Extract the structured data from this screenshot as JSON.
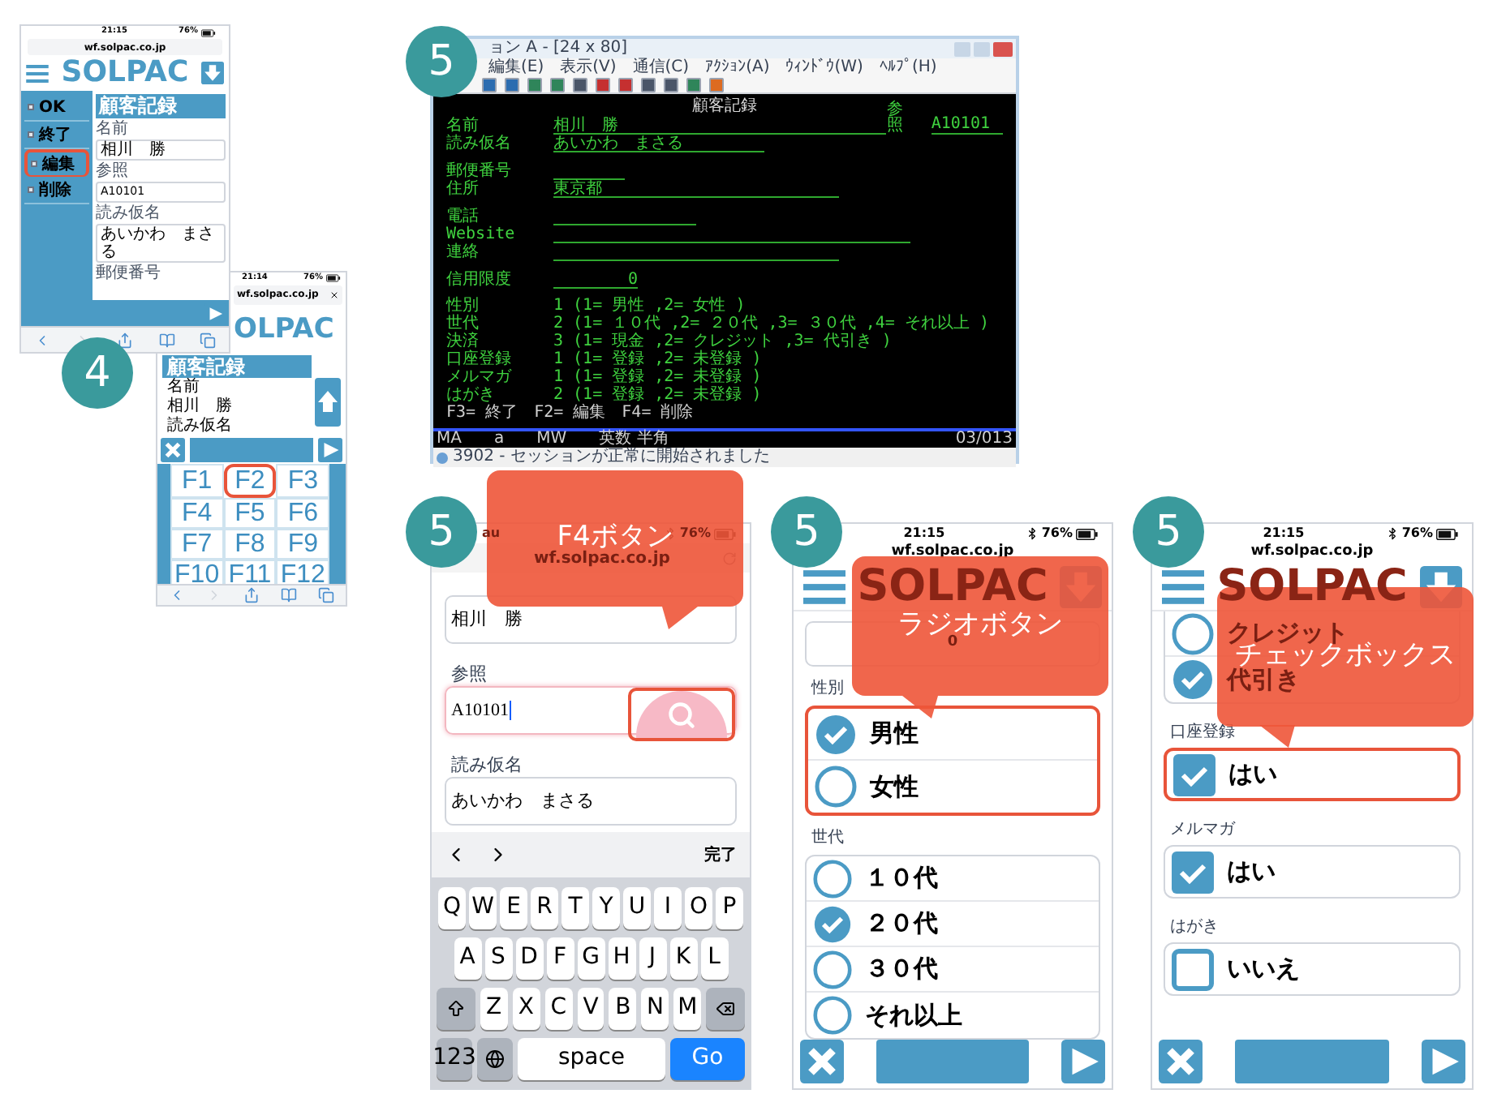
{
  "phone_menu": {
    "status": {
      "time": "21:15",
      "battery": "76%"
    },
    "url": "wf.solpac.co.jp",
    "logo": "SOLPAC",
    "menu": [
      {
        "label": "OK",
        "highlighted": false
      },
      {
        "label": "終了",
        "highlighted": false
      },
      {
        "label": "編集",
        "highlighted": true
      },
      {
        "label": "削除",
        "highlighted": false
      }
    ],
    "title": "顧客記録",
    "fields": [
      {
        "label": "名前",
        "value": "相川　勝"
      },
      {
        "label": "参照",
        "value": "A10101"
      },
      {
        "label": "読み仮名",
        "value": "あいかわ　まさる"
      },
      {
        "label": "郵便番号"
      }
    ]
  },
  "phone_fkeys": {
    "step": "4",
    "status": {
      "time": "21:14",
      "battery": "76%"
    },
    "url": "wf.solpac.co.jp",
    "logo": "OLPAC",
    "title": "顧客記録",
    "lines": [
      "名前",
      "相川　勝",
      "読み仮名"
    ],
    "keys": [
      {
        "label": "F1",
        "highlighted": false
      },
      {
        "label": "F2",
        "highlighted": true
      },
      {
        "label": "F3",
        "highlighted": false
      },
      {
        "label": "F4",
        "highlighted": false
      },
      {
        "label": "F5",
        "highlighted": false
      },
      {
        "label": "F6",
        "highlighted": false
      },
      {
        "label": "F7",
        "highlighted": false
      },
      {
        "label": "F8",
        "highlighted": false
      },
      {
        "label": "F9",
        "highlighted": false
      },
      {
        "label": "F10",
        "highlighted": false
      },
      {
        "label": "F11",
        "highlighted": false
      },
      {
        "label": "F12",
        "highlighted": false
      }
    ]
  },
  "terminal": {
    "step": "5",
    "title": "ョン A - [24 x 80]",
    "menu": [
      "編集(E)",
      "表示(V)",
      "通信(C)",
      "ｱｸｼｮﾝ(A)",
      "ｳｨﾝﾄﾞｳ(W)",
      "ﾍﾙﾌﾟ(H)"
    ],
    "heading": "顧客記録",
    "rows": [
      {
        "kind": "field",
        "label": "名前",
        "value": "相川　勝",
        "extra_label": "参照",
        "extra_value": "A10101"
      },
      {
        "kind": "field",
        "label": "読み仮名",
        "value": "あいかわ　まさる"
      },
      {
        "kind": "gap"
      },
      {
        "kind": "field",
        "label": "郵便番号"
      },
      {
        "kind": "field",
        "label": "住所",
        "value": "東京都"
      },
      {
        "kind": "gap"
      },
      {
        "kind": "field",
        "label": "電話"
      },
      {
        "kind": "field",
        "label": "Website"
      },
      {
        "kind": "field",
        "label": "連絡"
      },
      {
        "kind": "gap"
      },
      {
        "kind": "number",
        "label": "信用限度",
        "value": "0"
      },
      {
        "kind": "gap"
      },
      {
        "kind": "option",
        "label": "性別",
        "value": "1 (1= 男性 ,2= 女性 )"
      },
      {
        "kind": "option",
        "label": "世代",
        "value": "2 (1= １０代 ,2= ２０代 ,3= ３０代 ,4= それ以上 )"
      },
      {
        "kind": "option",
        "label": "決済",
        "value": "3 (1= 現金 ,2= クレジット ,3= 代引き )"
      },
      {
        "kind": "option",
        "label": "口座登録",
        "value": "1 (1= 登録 ,2= 未登録 )"
      },
      {
        "kind": "option",
        "label": "メルマガ",
        "value": "1 (1= 登録 ,2= 未登録 )"
      },
      {
        "kind": "option",
        "label": "はがき",
        "value": "2 (1= 登録 ,2= 未登録 )"
      }
    ],
    "function_keys": "F3= 終了　F2= 編集　F4= 削除",
    "indicators": [
      "MA",
      "a",
      "MW",
      "英数 半角"
    ],
    "cursor": "03/013",
    "status_bar": "3902 - セッションが正常に開始されました"
  },
  "phone_keyboard": {
    "step": "5",
    "callout": "F4ボタン",
    "status": {
      "carrier": "au",
      "battery": "76%"
    },
    "url": "wf.solpac.co.jp",
    "fields": [
      {
        "value": "相川　勝",
        "focused": false
      },
      {
        "label": "参照",
        "value": "A10101",
        "focused": true
      },
      {
        "label": "読み仮名",
        "value": "あいかわ　まさる",
        "focused": false
      }
    ],
    "search_highlighted": true,
    "done": "完了",
    "keyboard": [
      [
        {
          "kind": "key",
          "label": "Q"
        },
        {
          "kind": "key",
          "label": "W"
        },
        {
          "kind": "key",
          "label": "E"
        },
        {
          "kind": "key",
          "label": "R"
        },
        {
          "kind": "key",
          "label": "T"
        },
        {
          "kind": "key",
          "label": "Y"
        },
        {
          "kind": "key",
          "label": "U"
        },
        {
          "kind": "key",
          "label": "I"
        },
        {
          "kind": "key",
          "label": "O"
        },
        {
          "kind": "key",
          "label": "P"
        }
      ],
      [
        {
          "kind": "key",
          "label": "A"
        },
        {
          "kind": "key",
          "label": "S"
        },
        {
          "kind": "key",
          "label": "D"
        },
        {
          "kind": "key",
          "label": "F"
        },
        {
          "kind": "key",
          "label": "G"
        },
        {
          "kind": "key",
          "label": "H"
        },
        {
          "kind": "key",
          "label": "J"
        },
        {
          "kind": "key",
          "label": "K"
        },
        {
          "kind": "key",
          "label": "L"
        }
      ],
      [
        {
          "kind": "shift"
        },
        {
          "kind": "key",
          "label": "Z"
        },
        {
          "kind": "key",
          "label": "X"
        },
        {
          "kind": "key",
          "label": "C"
        },
        {
          "kind": "key",
          "label": "V"
        },
        {
          "kind": "key",
          "label": "B"
        },
        {
          "kind": "key",
          "label": "N"
        },
        {
          "kind": "key",
          "label": "M"
        },
        {
          "kind": "delete"
        }
      ],
      [
        {
          "kind": "mode",
          "label": "123"
        },
        {
          "kind": "globe"
        },
        {
          "kind": "space",
          "label": "space"
        },
        {
          "kind": "go",
          "label": "Go"
        }
      ]
    ]
  },
  "phone_radio": {
    "step": "5",
    "callout": "ラジオボタン",
    "status": {
      "time": "21:15",
      "battery": "76%"
    },
    "url": "wf.solpac.co.jp",
    "logo": "SOLPAC",
    "top_value": "0",
    "groups": [
      {
        "label": "性別",
        "highlighted": true,
        "options": [
          {
            "label": "男性",
            "selected": true
          },
          {
            "label": "女性",
            "selected": false
          }
        ]
      },
      {
        "label": "世代",
        "highlighted": false,
        "options": [
          {
            "label": "１０代",
            "selected": false
          },
          {
            "label": "２０代",
            "selected": true
          },
          {
            "label": "３０代",
            "selected": false
          },
          {
            "label": "それ以上",
            "selected": false
          }
        ]
      }
    ]
  },
  "phone_checkbox": {
    "step": "5",
    "callout": "チェックボックス",
    "status": {
      "time": "21:15",
      "battery": "76%"
    },
    "url": "wf.solpac.co.jp",
    "logo": "SOLPAC",
    "payment_options": [
      {
        "label": "クレジット",
        "selected": false
      },
      {
        "label": "代引き",
        "selected": true
      }
    ],
    "checks": [
      {
        "label": "口座登録",
        "option": "はい",
        "checked": true,
        "highlighted": true
      },
      {
        "label": "メルマガ",
        "option": "はい",
        "checked": true,
        "highlighted": false
      },
      {
        "label": "はがき",
        "option": "いいえ",
        "checked": false,
        "highlighted": false
      }
    ]
  }
}
